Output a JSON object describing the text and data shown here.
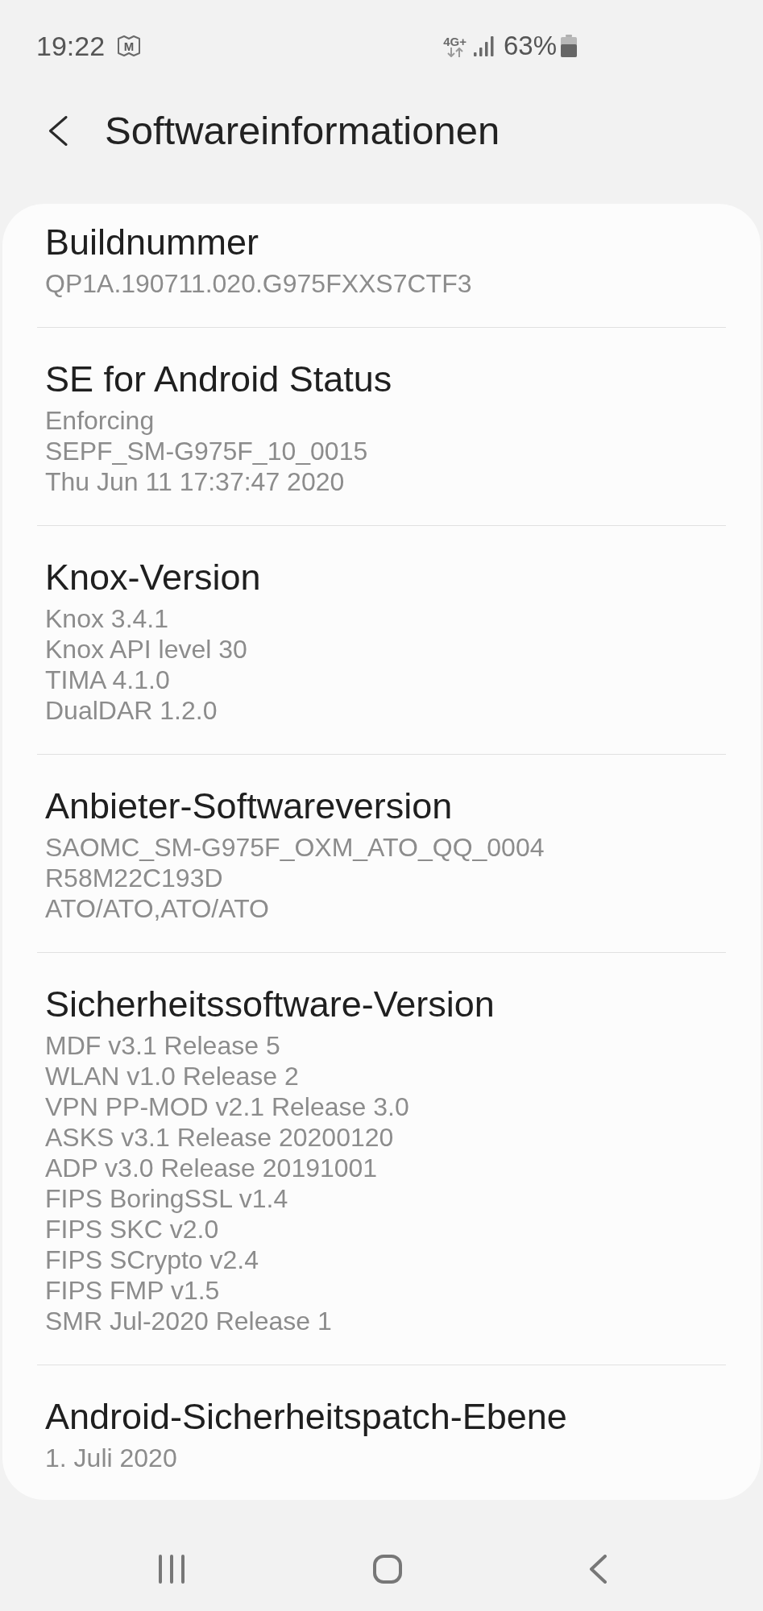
{
  "status_bar": {
    "time": "19:22",
    "notification_badge": "M",
    "network_type": "4G+",
    "battery": "63%"
  },
  "header": {
    "title": "Softwareinformationen"
  },
  "sections": [
    {
      "title": "Buildnummer",
      "lines": [
        "QP1A.190711.020.G975FXXS7CTF3"
      ]
    },
    {
      "title": "SE for Android Status",
      "lines": [
        "Enforcing",
        "SEPF_SM-G975F_10_0015",
        "Thu Jun 11 17:37:47 2020"
      ]
    },
    {
      "title": "Knox-Version",
      "lines": [
        "Knox 3.4.1",
        "Knox API level 30",
        "TIMA 4.1.0",
        "DualDAR 1.2.0"
      ]
    },
    {
      "title": "Anbieter-Softwareversion",
      "lines": [
        "SAOMC_SM-G975F_OXM_ATO_QQ_0004",
        "R58M22C193D",
        "ATO/ATO,ATO/ATO"
      ]
    },
    {
      "title": "Sicherheitssoftware-Version",
      "lines": [
        "MDF v3.1 Release 5",
        "WLAN v1.0 Release 2",
        "VPN PP-MOD v2.1 Release 3.0",
        "ASKS v3.1 Release 20200120",
        "ADP v3.0 Release 20191001",
        "FIPS BoringSSL v1.4",
        "FIPS SKC v2.0",
        "FIPS SCrypto v2.4",
        "FIPS FMP v1.5",
        "SMR Jul-2020 Release 1"
      ]
    },
    {
      "title": "Android-Sicherheitspatch-Ebene",
      "lines": [
        "1. Juli 2020"
      ]
    }
  ]
}
